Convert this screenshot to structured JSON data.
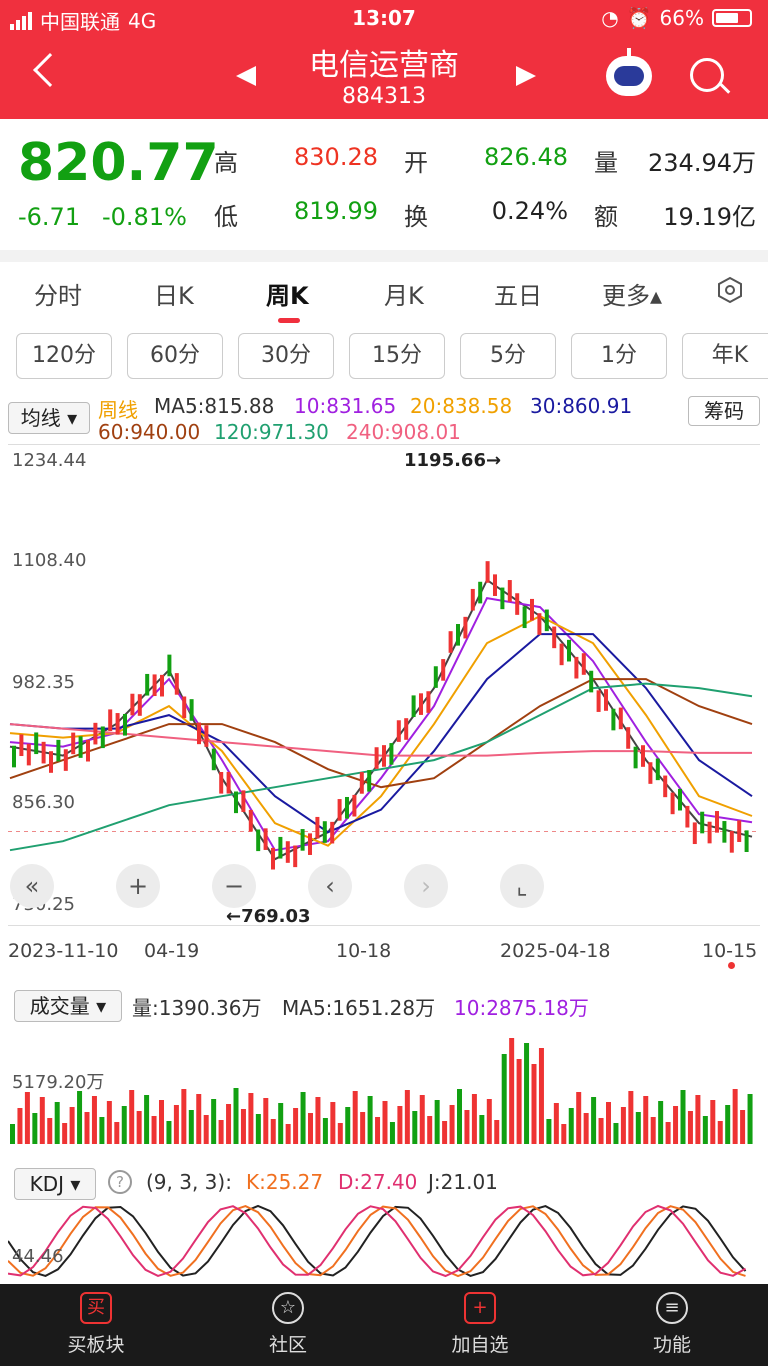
{
  "status": {
    "carrier": "中国联通",
    "net": "4G",
    "time": "13:07",
    "battery": "66%"
  },
  "header": {
    "title": "电信运营商",
    "code": "884313"
  },
  "quote": {
    "price": "820.77",
    "change": "-6.71",
    "change_pct": "-0.81%",
    "high_label": "高",
    "high": "830.28",
    "low_label": "低",
    "low": "819.99",
    "open_label": "开",
    "open": "826.48",
    "turn_label": "换",
    "turn": "0.24%",
    "vol_label": "量",
    "vol": "234.94万",
    "amt_label": "额",
    "amt": "19.19亿"
  },
  "tabs": [
    "分时",
    "日K",
    "周K",
    "月K",
    "五日",
    "更多▴"
  ],
  "periods": [
    "120分",
    "60分",
    "30分",
    "15分",
    "5分",
    "1分",
    "年K"
  ],
  "ma": {
    "selector": "均线 ▾",
    "period": "周线",
    "ma5": "MA5:815.88",
    "ma10": "10:831.65",
    "ma20": "20:838.58",
    "ma30": "30:860.91",
    "ma60": "60:940.00",
    "ma120": "120:971.30",
    "ma240": "240:908.01",
    "chip_btn": "筹码"
  },
  "axis": {
    "y": [
      "1234.44",
      "1108.40",
      "982.35",
      "856.30",
      "730.25"
    ],
    "x": [
      "2023-11-10",
      "04-19",
      "10-18",
      "2025-04-18",
      "10-15"
    ],
    "high_mark": "1195.66→",
    "low_mark": "←769.03"
  },
  "volume": {
    "selector": "成交量 ▾",
    "vol": "量:1390.36万",
    "ma5": "MA5:1651.28万",
    "ma10": "10:2875.18万",
    "ylab": "5179.20万"
  },
  "kdj": {
    "selector": "KDJ ▾",
    "params": "(9, 3, 3):",
    "k": "K:25.27",
    "d": "D:27.40",
    "j": "J:21.01",
    "ylab": "44.46"
  },
  "bottom": [
    "买板块",
    "社区",
    "加自选",
    "功能"
  ],
  "colors": {
    "red": "#f0303e",
    "green": "#12a012"
  },
  "chart_data": {
    "type": "line",
    "title": "",
    "x": [
      "2023-11-10",
      "04-19",
      "10-18",
      "2025-04-18",
      "10-15"
    ],
    "ylim": [
      730.25,
      1234.44
    ],
    "series": [
      {
        "name": "MA5",
        "values": [
          915,
          905,
          940,
          1000,
          880,
          790,
          820,
          900,
          980,
          1100,
          1060,
          990,
          900,
          830,
          815
        ]
      },
      {
        "name": "10",
        "values": [
          920,
          915,
          930,
          990,
          900,
          800,
          810,
          880,
          960,
          1080,
          1070,
          1010,
          920,
          840,
          831
        ]
      },
      {
        "name": "20",
        "values": [
          930,
          925,
          930,
          960,
          910,
          830,
          805,
          860,
          940,
          1030,
          1060,
          1030,
          950,
          860,
          838
        ]
      },
      {
        "name": "30",
        "values": [
          940,
          935,
          935,
          950,
          920,
          860,
          820,
          845,
          910,
          990,
          1040,
          1040,
          980,
          900,
          860
        ]
      },
      {
        "name": "60",
        "values": [
          880,
          900,
          920,
          940,
          940,
          920,
          890,
          870,
          880,
          920,
          960,
          990,
          990,
          960,
          940
        ]
      },
      {
        "name": "120",
        "values": [
          800,
          810,
          830,
          850,
          860,
          870,
          880,
          890,
          900,
          920,
          950,
          980,
          985,
          980,
          971
        ]
      },
      {
        "name": "240",
        "values": [
          940,
          935,
          930,
          925,
          920,
          915,
          910,
          905,
          905,
          905,
          908,
          910,
          910,
          908,
          908
        ]
      }
    ]
  }
}
